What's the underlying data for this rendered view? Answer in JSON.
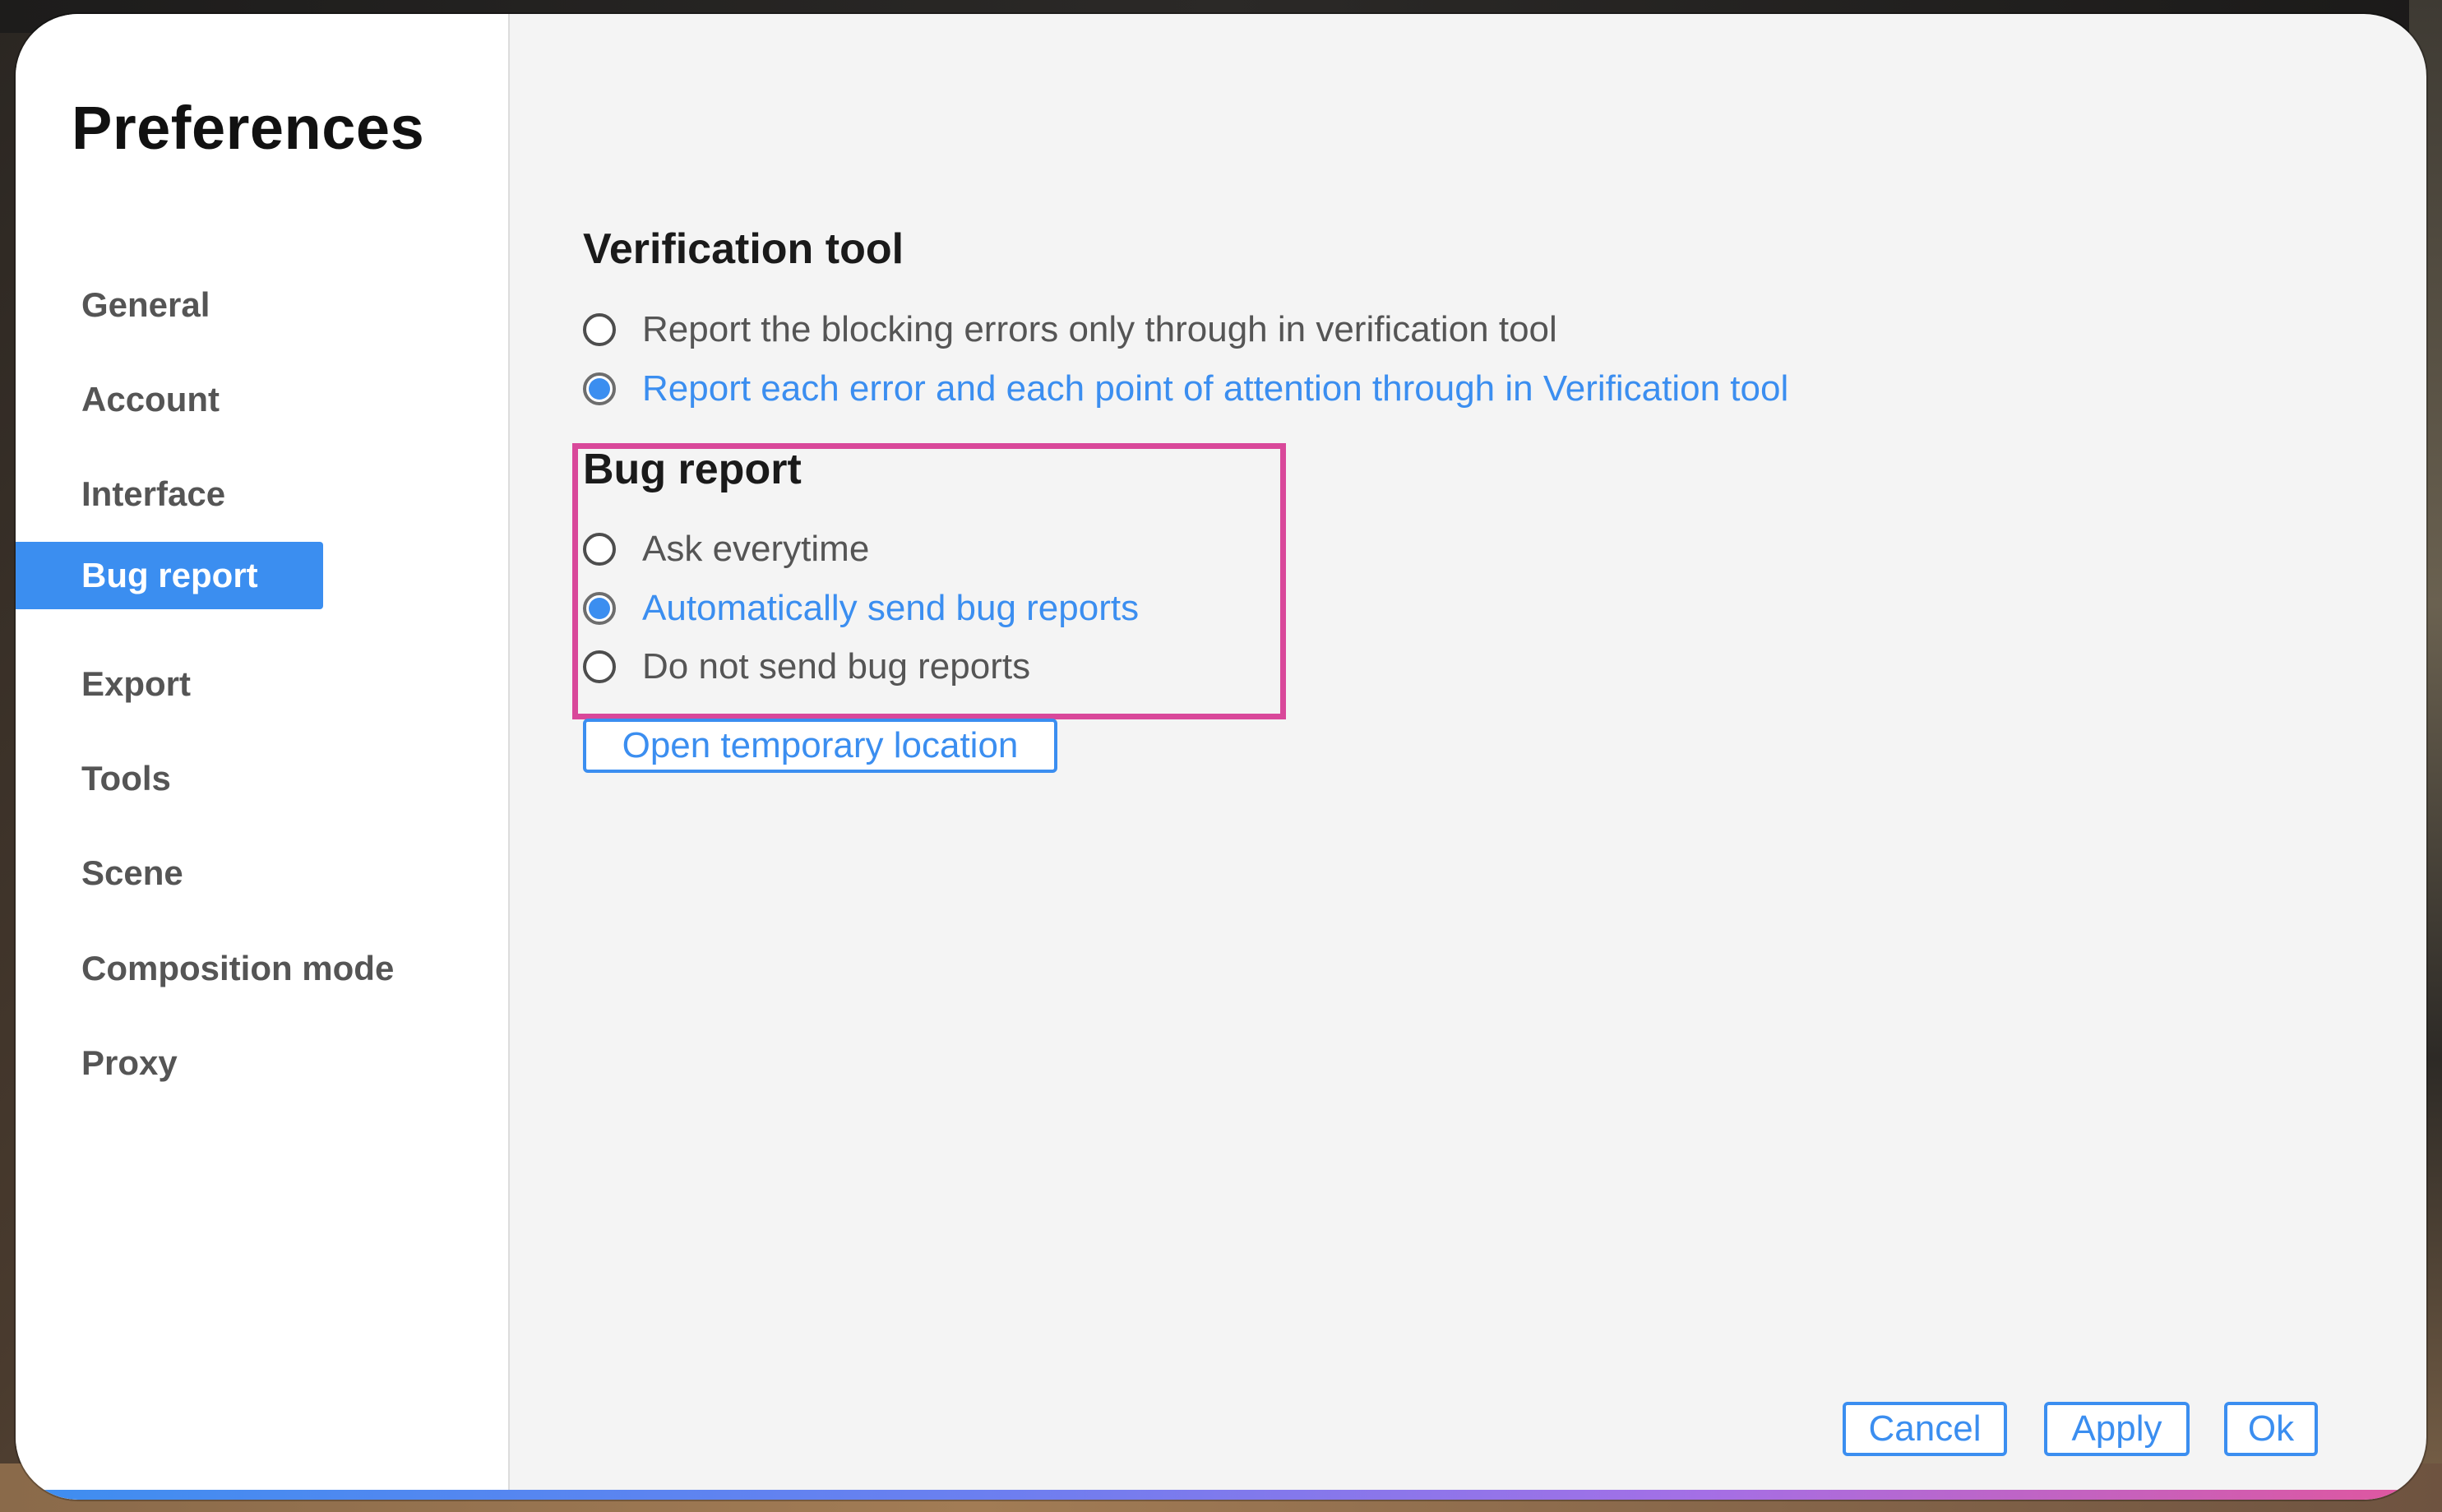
{
  "window": {
    "title": "Preferences"
  },
  "sidebar": {
    "items": [
      {
        "label": "General",
        "active": false
      },
      {
        "label": "Account",
        "active": false
      },
      {
        "label": "Interface",
        "active": false
      },
      {
        "label": "Bug report",
        "active": true
      },
      {
        "label": "Export",
        "active": false
      },
      {
        "label": "Tools",
        "active": false
      },
      {
        "label": "Scene",
        "active": false
      },
      {
        "label": "Composition mode",
        "active": false
      },
      {
        "label": "Proxy",
        "active": false
      }
    ]
  },
  "verification": {
    "heading": "Verification tool",
    "options": [
      {
        "label": "Report the blocking errors only through in verification tool",
        "checked": false
      },
      {
        "label": "Report each error and each point of attention through in Verification tool",
        "checked": true
      }
    ]
  },
  "bug_report": {
    "heading": "Bug report",
    "options": [
      {
        "label": "Ask everytime",
        "checked": false
      },
      {
        "label": "Automatically send bug reports",
        "checked": true
      },
      {
        "label": "Do not send bug reports",
        "checked": false
      }
    ],
    "open_location_label": "Open temporary location"
  },
  "footer": {
    "cancel_label": "Cancel",
    "apply_label": "Apply",
    "ok_label": "Ok"
  },
  "colors": {
    "accent": "#3b8ef0",
    "highlight": "#d9489a",
    "panel_background": "#f4f4f4",
    "sidebar_background": "#ffffff"
  }
}
